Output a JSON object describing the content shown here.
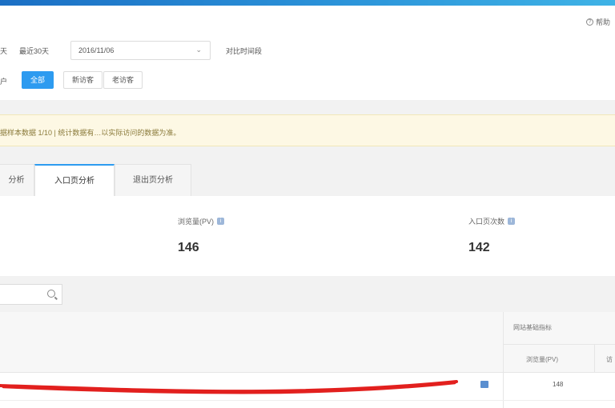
{
  "header": {
    "help_label": "帮助"
  },
  "filters": {
    "row1": {
      "prefix_label": "天",
      "quick_range_label": "最近30天",
      "date_range_value": "2016/11/06",
      "compare_label": "对比时间段"
    },
    "row2": {
      "prefix_label": "户",
      "options": [
        "全部",
        "新访客",
        "老访客"
      ],
      "selected": "全部"
    }
  },
  "notice": {
    "text": "据样本数据 1/10 | 统计数据有…以实际访问的数据为准。"
  },
  "tabs": [
    {
      "label": "分析",
      "active": false
    },
    {
      "label": "入口页分析",
      "active": true
    },
    {
      "label": "退出页分析",
      "active": false
    }
  ],
  "metrics": [
    {
      "label": "浏览量(PV)",
      "value": "146"
    },
    {
      "label": "入口页次数",
      "value": "142"
    }
  ],
  "search": {
    "placeholder": ""
  },
  "table": {
    "group_header": "网站基础指标",
    "columns": [
      "浏览量(PV)",
      "访"
    ],
    "rows": [
      {
        "value": "148"
      }
    ]
  },
  "colors": {
    "accent": "#2d9bf0",
    "notice_bg": "#fdf8e4",
    "annotation": "#e2201e"
  },
  "icons": {
    "help": "question-circle-icon",
    "dropdown": "chevron-down-icon",
    "info": "info-icon",
    "search": "search-icon",
    "row_action": "chart-icon"
  }
}
